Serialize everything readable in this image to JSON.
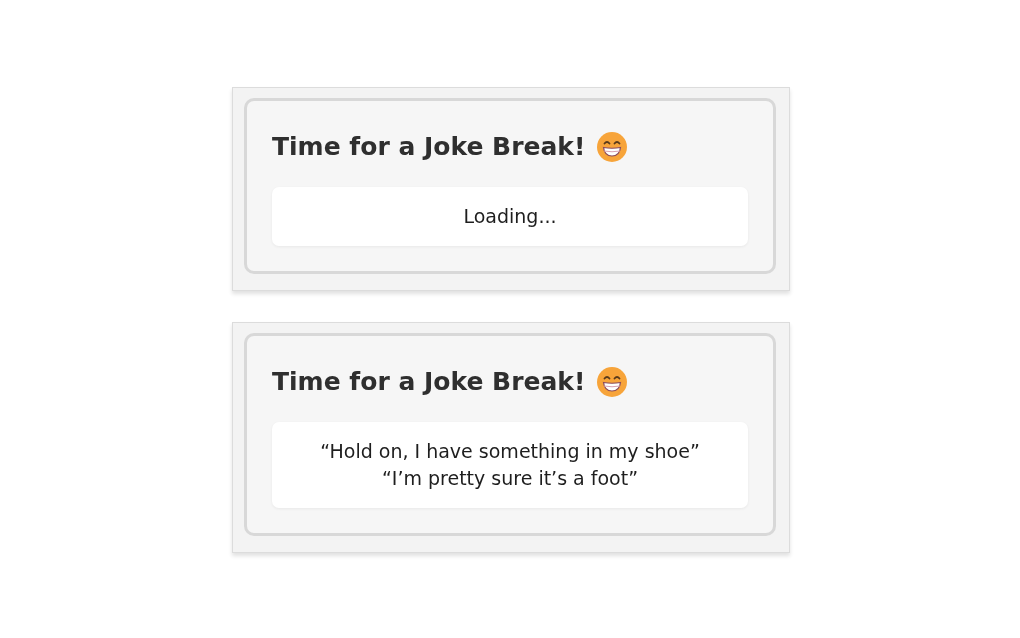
{
  "cards": [
    {
      "title": "Time for a Joke Break!",
      "lines": [
        "Loading..."
      ]
    },
    {
      "title": "Time for a Joke Break!",
      "lines": [
        "“Hold on, I have something in my shoe”",
        "“I’m pretty sure it’s a foot”"
      ]
    }
  ]
}
